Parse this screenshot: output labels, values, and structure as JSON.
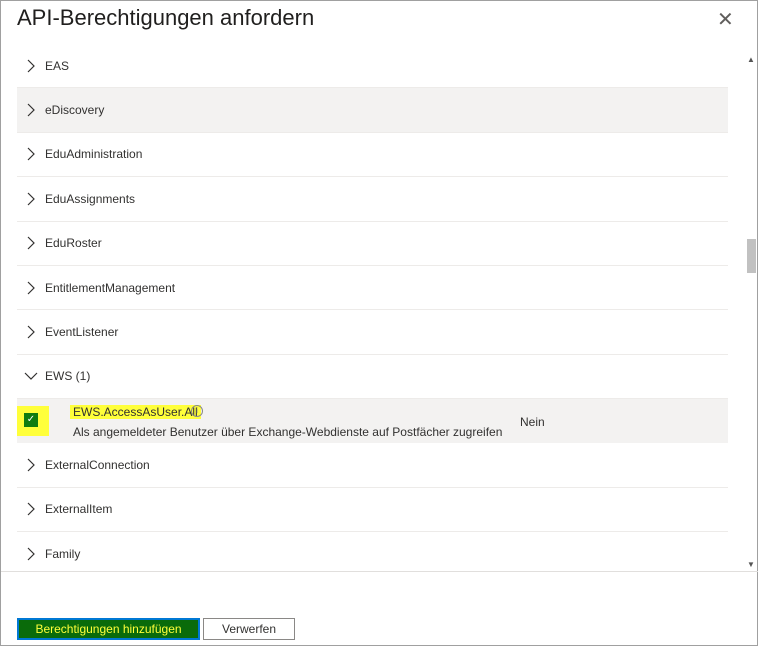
{
  "dialog": {
    "title": "API-Berechtigungen anfordern",
    "close_icon": "close-icon"
  },
  "list": {
    "items_before": [
      "EAS",
      "eDiscovery",
      "EduAdministration",
      "EduAssignments",
      "EduRoster",
      "EntitlementManagement",
      "EventListener"
    ],
    "expanded": {
      "label": "EWS (1)",
      "permission": {
        "name": "EWS.AccessAsUser.All",
        "description": "Als angemeldeter Benutzer über Exchange-Webdienste auf Postfächer zugreifen",
        "admin_consent": "Nein",
        "checked": true
      }
    },
    "items_after": [
      "ExternalConnection",
      "ExternalItem",
      "Family"
    ]
  },
  "footer": {
    "add_label": "Berechtigungen hinzufügen",
    "discard_label": "Verwerfen"
  }
}
